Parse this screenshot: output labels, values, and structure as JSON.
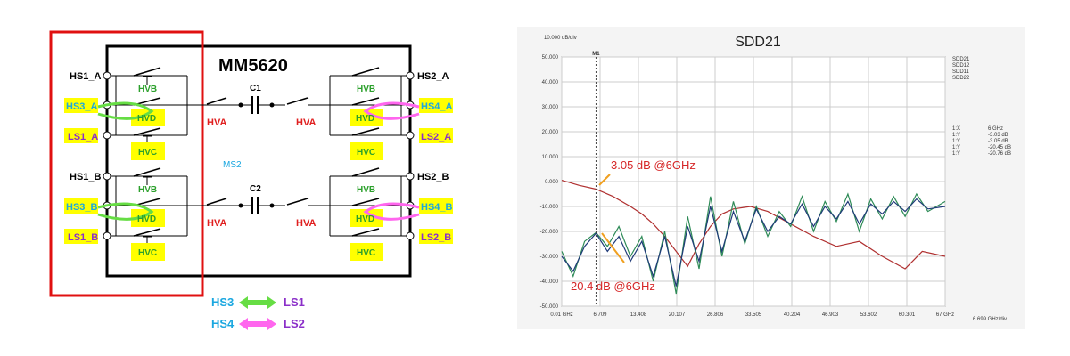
{
  "schematic": {
    "title": "MM5620",
    "center_label": "MS2",
    "capacitors": [
      "C1",
      "C2"
    ],
    "left_ports": [
      "HS1_A",
      "HS3_A",
      "LS1_A",
      "HS1_B",
      "HS3_B",
      "LS1_B"
    ],
    "right_ports": [
      "HS2_A",
      "HS4_A",
      "LS2_A",
      "HS2_B",
      "HS4_B",
      "LS2_B"
    ],
    "switch_labels": {
      "hvb": "HVB",
      "hvd": "HVD",
      "hvc": "HVC",
      "hva": "HVA"
    },
    "legend": [
      {
        "from": "HS3",
        "to": "LS1",
        "arrow_color": "#66dd44"
      },
      {
        "from": "HS4",
        "to": "LS2",
        "arrow_color": "#ff66ee"
      }
    ],
    "colors": {
      "highlight": "#ffff00",
      "frame": "#e01010",
      "port_cyan": "#1aa7e0",
      "ls_purple": "#8b2fc9",
      "hva_red": "#e02020",
      "hv_green": "#2ca02c"
    }
  },
  "chart_data": {
    "type": "line",
    "title": "SDD21",
    "y_scale_label": "10.000 dB/div",
    "x_scale_label": "6.699 GHz/div",
    "x_tick_labels": [
      "0.01 GHz",
      "6.709",
      "13.408",
      "20.107",
      "26.806",
      "33.505",
      "40.204",
      "46.903",
      "53.602",
      "60.301",
      "67 GHz"
    ],
    "y_tick_labels": [
      "50.000",
      "40.000",
      "30.000",
      "20.000",
      "10.000",
      "0.000",
      "-10.000",
      "-20.000",
      "-30.000",
      "-40.000",
      "-50.000"
    ],
    "xlim": [
      0.01,
      67
    ],
    "ylim": [
      -50,
      50
    ],
    "marker": {
      "name": "M1",
      "x": 6
    },
    "legend": [
      "SDD21",
      "SDD12",
      "SDD11",
      "SDD22"
    ],
    "legend_colors": [
      "#1f3a93",
      "#c0392b",
      "#2e8b57",
      "#3a5fcd"
    ],
    "marker_readout": [
      {
        "key": "1:X",
        "value": "6 GHz"
      },
      {
        "key": "1:Y",
        "value": "-3.03 dB"
      },
      {
        "key": "1:Y",
        "value": "-3.05 dB"
      },
      {
        "key": "1:Y",
        "value": "-20.45 dB"
      },
      {
        "key": "1:Y",
        "value": "-20.76 dB"
      }
    ],
    "annotations": [
      "3.05 dB @6GHz",
      "20.4 dB @6GHz"
    ],
    "series": [
      {
        "name": "SDD21",
        "color": "#b03030",
        "x": [
          0.01,
          3,
          6,
          9,
          12,
          14,
          16,
          18,
          20,
          22,
          24,
          26,
          28,
          30,
          33,
          36,
          40,
          44,
          48,
          52,
          56,
          60,
          63,
          67
        ],
        "y": [
          0.5,
          -1.5,
          -3.05,
          -6,
          -10,
          -13,
          -17,
          -22,
          -28,
          -34,
          -25,
          -18,
          -13,
          -11,
          -10,
          -12,
          -17,
          -22,
          -26,
          -24,
          -30,
          -35,
          -28,
          -30
        ]
      },
      {
        "name": "SDD11",
        "color": "#2e8b57",
        "x": [
          0.01,
          2,
          4,
          6,
          8,
          10,
          12,
          14,
          16,
          18,
          20,
          22,
          24,
          26,
          28,
          30,
          32,
          34,
          36,
          38,
          40,
          42,
          44,
          46,
          48,
          50,
          52,
          54,
          56,
          58,
          60,
          62,
          64,
          67
        ],
        "y": [
          -28,
          -38,
          -24,
          -20.45,
          -26,
          -18,
          -30,
          -22,
          -40,
          -20,
          -45,
          -14,
          -35,
          -6,
          -30,
          -8,
          -25,
          -10,
          -22,
          -12,
          -18,
          -6,
          -20,
          -8,
          -16,
          -5,
          -20,
          -7,
          -15,
          -6,
          -14,
          -5,
          -12,
          -8
        ]
      },
      {
        "name": "SDD22",
        "color": "#1f3a78",
        "x": [
          0.01,
          2,
          4,
          6,
          8,
          10,
          12,
          14,
          16,
          18,
          20,
          22,
          24,
          26,
          28,
          30,
          32,
          34,
          36,
          38,
          40,
          42,
          44,
          46,
          48,
          50,
          52,
          54,
          56,
          58,
          60,
          62,
          64,
          67
        ],
        "y": [
          -30,
          -36,
          -26,
          -20.76,
          -28,
          -22,
          -32,
          -24,
          -38,
          -22,
          -42,
          -18,
          -32,
          -10,
          -28,
          -12,
          -24,
          -11,
          -20,
          -14,
          -17,
          -9,
          -18,
          -10,
          -15,
          -8,
          -17,
          -9,
          -13,
          -8,
          -12,
          -7,
          -11,
          -10
        ]
      }
    ]
  }
}
